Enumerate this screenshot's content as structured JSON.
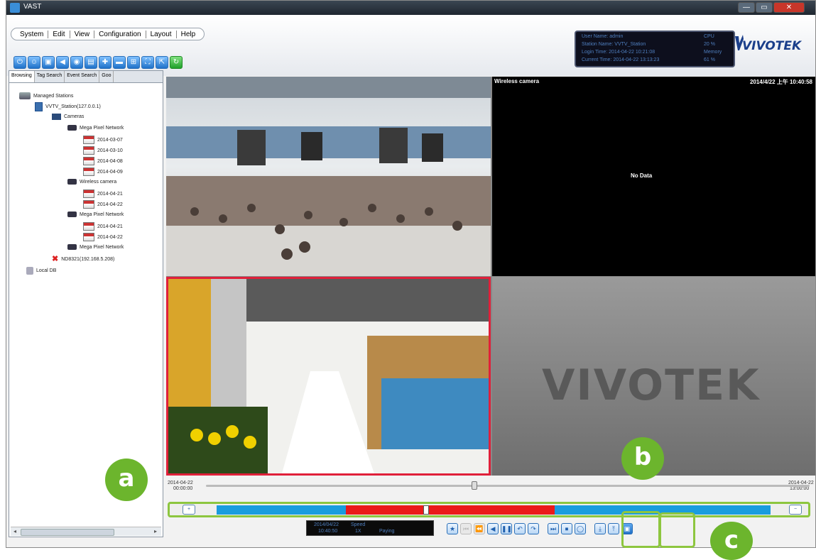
{
  "window": {
    "title": "VAST",
    "controls": {
      "minimize": "—",
      "maximize": "▭",
      "close": "✕"
    }
  },
  "menu": [
    "System",
    "Edit",
    "View",
    "Configuration",
    "Layout",
    "Help"
  ],
  "toolbar": {
    "icons": [
      "power-icon",
      "user-icon",
      "lock-icon",
      "speaker-icon",
      "snapshot-icon",
      "print-icon",
      "pin-icon",
      "camera-icon",
      "grid-icon",
      "fullscreen-icon",
      "export-icon",
      "refresh-icon"
    ]
  },
  "status": {
    "line1": "User Name: admin",
    "line2": "Station Name: VVTV_Station",
    "line3": "Login Time: 2014-04-22 10:21:08",
    "line4": "Current Time: 2014-04-22 13:13:23",
    "cpu_label": "CPU",
    "cpu_value": "20 %",
    "memory_label": "Memory",
    "memory_value": "61 %"
  },
  "brand": "VIVOTEK",
  "left_tabs": [
    "Browsing",
    "Tag Search",
    "Event Search",
    "Goo"
  ],
  "tree": {
    "managed": "Managed Stations",
    "station": "VVTV_Station(127.0.0.1)",
    "cameras": "Cameras",
    "cam1": "Mega Pixel Network",
    "cam1_clips": [
      "2014-03-07",
      "2014-03-10",
      "2014-04-08",
      "2014-04-09"
    ],
    "cam2": "Wireless camera",
    "cam2_clips": [
      "2014-04-21",
      "2014-04-22"
    ],
    "cam3": "Mega Pixel Network",
    "cam3_clips": [
      "2014-04-21",
      "2014-04-22"
    ],
    "cam4": "Mega Pixel Network",
    "nvr": "ND8321(192.168.5.208)",
    "local": "Local DB"
  },
  "tiles": {
    "tile2_label": "Wireless camera",
    "tile2_time": "2014/4/22 上午 10:40:58",
    "no_data": "No Data",
    "watermark": "VIVOTEK"
  },
  "timeline": {
    "start_date": "2014-04-22",
    "start_time": "00:00:00",
    "end_date": "2014-04-22",
    "end_time": "13:00:00",
    "zoom_in": "+",
    "zoom_out": "−",
    "playback_position": 0.44
  },
  "time_display": {
    "date": "2014/04/22",
    "time": "10:40:50",
    "speed_label": "Speed",
    "speed": "1X",
    "state": "Paying"
  },
  "callouts": {
    "a": "a",
    "b": "b",
    "c": "c"
  },
  "colors": {
    "recorded": "#1a9cde",
    "event": "#ea1a1a",
    "highlight": "#8dc63f",
    "selected_tile": "#e0203a"
  }
}
